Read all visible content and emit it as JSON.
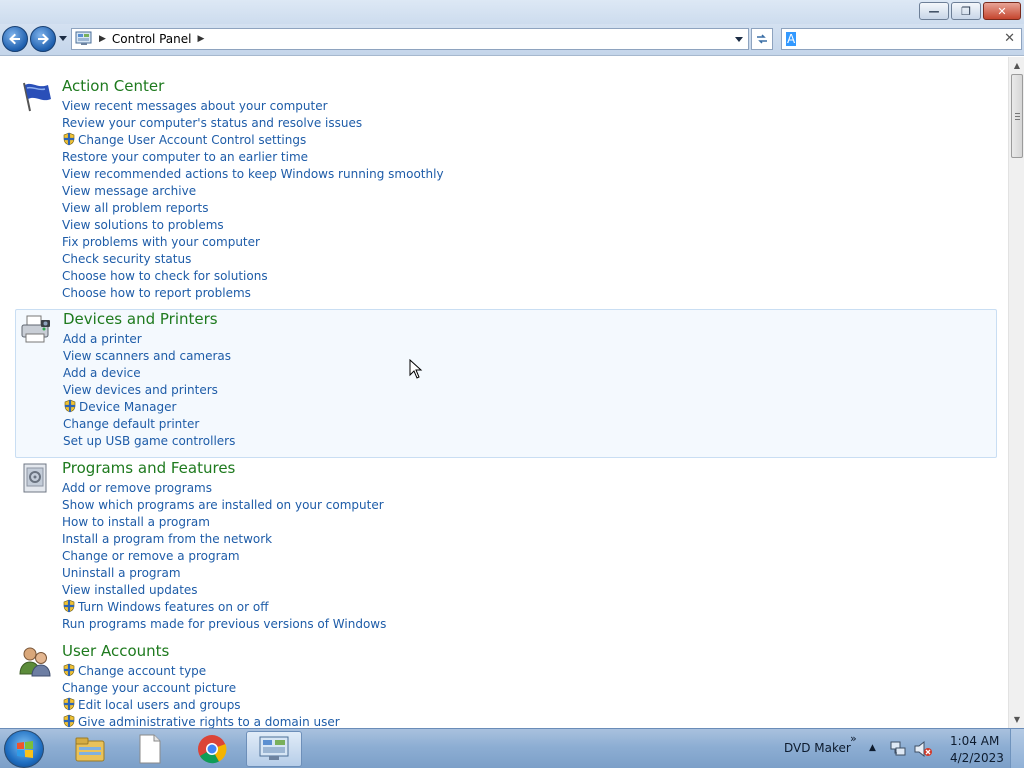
{
  "window": {
    "minimize_symbol": "—",
    "restore_symbol": "❐",
    "close_symbol": "✕"
  },
  "address_bar": {
    "breadcrumb": [
      "Control Panel"
    ],
    "search_placeholder": "",
    "search_value": "A"
  },
  "categories": [
    {
      "title": "Action Center",
      "icon": "action-center-flag-icon",
      "links": [
        {
          "label": "View recent messages about your computer",
          "shield": false
        },
        {
          "label": "Review your computer's status and resolve issues",
          "shield": false
        },
        {
          "label": "Change User Account Control settings",
          "shield": true
        },
        {
          "label": "Restore your computer to an earlier time",
          "shield": false
        },
        {
          "label": "View recommended actions to keep Windows running smoothly",
          "shield": false
        },
        {
          "label": "View message archive",
          "shield": false
        },
        {
          "label": "View all problem reports",
          "shield": false
        },
        {
          "label": "View solutions to problems",
          "shield": false
        },
        {
          "label": "Fix problems with your computer",
          "shield": false
        },
        {
          "label": "Check security status",
          "shield": false
        },
        {
          "label": "Choose how to check for solutions",
          "shield": false
        },
        {
          "label": "Choose how to report problems",
          "shield": false
        }
      ]
    },
    {
      "title": "Devices and Printers",
      "icon": "printer-icon",
      "links": [
        {
          "label": "Add a printer",
          "shield": false
        },
        {
          "label": "View scanners and cameras",
          "shield": false
        },
        {
          "label": "Add a device",
          "shield": false
        },
        {
          "label": "View devices and printers",
          "shield": false
        },
        {
          "label": "Device Manager",
          "shield": true
        },
        {
          "label": "Change default printer",
          "shield": false
        },
        {
          "label": "Set up USB game controllers",
          "shield": false
        }
      ]
    },
    {
      "title": "Programs and Features",
      "icon": "programs-features-icon",
      "links": [
        {
          "label": "Add or remove programs",
          "shield": false
        },
        {
          "label": "Show which programs are installed on your computer",
          "shield": false
        },
        {
          "label": "How to install a program",
          "shield": false
        },
        {
          "label": "Install a program from the network",
          "shield": false
        },
        {
          "label": "Change or remove a program",
          "shield": false
        },
        {
          "label": "Uninstall a program",
          "shield": false
        },
        {
          "label": "View installed updates",
          "shield": false
        },
        {
          "label": "Turn Windows features on or off",
          "shield": true
        },
        {
          "label": "Run programs made for previous versions of Windows",
          "shield": false
        }
      ]
    },
    {
      "title": "User Accounts",
      "icon": "user-accounts-icon",
      "links": [
        {
          "label": "Change account type",
          "shield": true
        },
        {
          "label": "Change your account picture",
          "shield": false
        },
        {
          "label": "Edit local users and groups",
          "shield": true
        },
        {
          "label": "Give administrative rights to a domain user",
          "shield": true
        }
      ]
    }
  ],
  "taskbar": {
    "items": [
      "windows-explorer-icon",
      "blank-document-icon",
      "chrome-icon",
      "control-panel-icon"
    ],
    "tray_app_label": "DVD Maker",
    "time": "1:04 AM",
    "date": "4/2/2023"
  },
  "colors": {
    "category_title": "#1e7a1e",
    "link": "#1e5ca8",
    "hover_bg": "#f4f9fe"
  }
}
